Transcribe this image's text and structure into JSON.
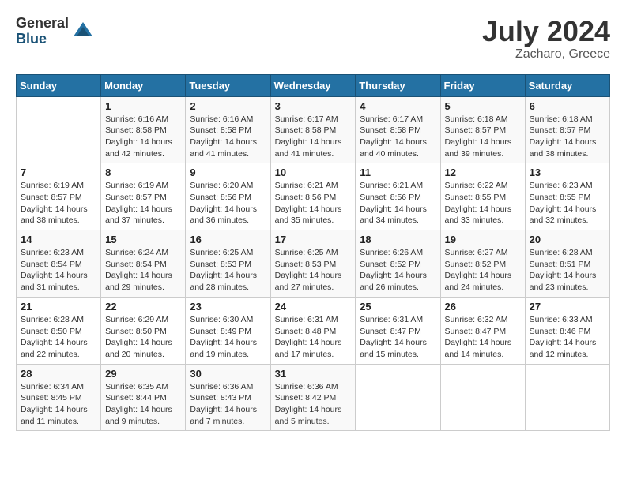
{
  "logo": {
    "general": "General",
    "blue": "Blue"
  },
  "title": {
    "month_year": "July 2024",
    "location": "Zacharo, Greece"
  },
  "headers": [
    "Sunday",
    "Monday",
    "Tuesday",
    "Wednesday",
    "Thursday",
    "Friday",
    "Saturday"
  ],
  "weeks": [
    [
      {
        "day": "",
        "info": ""
      },
      {
        "day": "1",
        "info": "Sunrise: 6:16 AM\nSunset: 8:58 PM\nDaylight: 14 hours\nand 42 minutes."
      },
      {
        "day": "2",
        "info": "Sunrise: 6:16 AM\nSunset: 8:58 PM\nDaylight: 14 hours\nand 41 minutes."
      },
      {
        "day": "3",
        "info": "Sunrise: 6:17 AM\nSunset: 8:58 PM\nDaylight: 14 hours\nand 41 minutes."
      },
      {
        "day": "4",
        "info": "Sunrise: 6:17 AM\nSunset: 8:58 PM\nDaylight: 14 hours\nand 40 minutes."
      },
      {
        "day": "5",
        "info": "Sunrise: 6:18 AM\nSunset: 8:57 PM\nDaylight: 14 hours\nand 39 minutes."
      },
      {
        "day": "6",
        "info": "Sunrise: 6:18 AM\nSunset: 8:57 PM\nDaylight: 14 hours\nand 38 minutes."
      }
    ],
    [
      {
        "day": "7",
        "info": "Sunrise: 6:19 AM\nSunset: 8:57 PM\nDaylight: 14 hours\nand 38 minutes."
      },
      {
        "day": "8",
        "info": "Sunrise: 6:19 AM\nSunset: 8:57 PM\nDaylight: 14 hours\nand 37 minutes."
      },
      {
        "day": "9",
        "info": "Sunrise: 6:20 AM\nSunset: 8:56 PM\nDaylight: 14 hours\nand 36 minutes."
      },
      {
        "day": "10",
        "info": "Sunrise: 6:21 AM\nSunset: 8:56 PM\nDaylight: 14 hours\nand 35 minutes."
      },
      {
        "day": "11",
        "info": "Sunrise: 6:21 AM\nSunset: 8:56 PM\nDaylight: 14 hours\nand 34 minutes."
      },
      {
        "day": "12",
        "info": "Sunrise: 6:22 AM\nSunset: 8:55 PM\nDaylight: 14 hours\nand 33 minutes."
      },
      {
        "day": "13",
        "info": "Sunrise: 6:23 AM\nSunset: 8:55 PM\nDaylight: 14 hours\nand 32 minutes."
      }
    ],
    [
      {
        "day": "14",
        "info": "Sunrise: 6:23 AM\nSunset: 8:54 PM\nDaylight: 14 hours\nand 31 minutes."
      },
      {
        "day": "15",
        "info": "Sunrise: 6:24 AM\nSunset: 8:54 PM\nDaylight: 14 hours\nand 29 minutes."
      },
      {
        "day": "16",
        "info": "Sunrise: 6:25 AM\nSunset: 8:53 PM\nDaylight: 14 hours\nand 28 minutes."
      },
      {
        "day": "17",
        "info": "Sunrise: 6:25 AM\nSunset: 8:53 PM\nDaylight: 14 hours\nand 27 minutes."
      },
      {
        "day": "18",
        "info": "Sunrise: 6:26 AM\nSunset: 8:52 PM\nDaylight: 14 hours\nand 26 minutes."
      },
      {
        "day": "19",
        "info": "Sunrise: 6:27 AM\nSunset: 8:52 PM\nDaylight: 14 hours\nand 24 minutes."
      },
      {
        "day": "20",
        "info": "Sunrise: 6:28 AM\nSunset: 8:51 PM\nDaylight: 14 hours\nand 23 minutes."
      }
    ],
    [
      {
        "day": "21",
        "info": "Sunrise: 6:28 AM\nSunset: 8:50 PM\nDaylight: 14 hours\nand 22 minutes."
      },
      {
        "day": "22",
        "info": "Sunrise: 6:29 AM\nSunset: 8:50 PM\nDaylight: 14 hours\nand 20 minutes."
      },
      {
        "day": "23",
        "info": "Sunrise: 6:30 AM\nSunset: 8:49 PM\nDaylight: 14 hours\nand 19 minutes."
      },
      {
        "day": "24",
        "info": "Sunrise: 6:31 AM\nSunset: 8:48 PM\nDaylight: 14 hours\nand 17 minutes."
      },
      {
        "day": "25",
        "info": "Sunrise: 6:31 AM\nSunset: 8:47 PM\nDaylight: 14 hours\nand 15 minutes."
      },
      {
        "day": "26",
        "info": "Sunrise: 6:32 AM\nSunset: 8:47 PM\nDaylight: 14 hours\nand 14 minutes."
      },
      {
        "day": "27",
        "info": "Sunrise: 6:33 AM\nSunset: 8:46 PM\nDaylight: 14 hours\nand 12 minutes."
      }
    ],
    [
      {
        "day": "28",
        "info": "Sunrise: 6:34 AM\nSunset: 8:45 PM\nDaylight: 14 hours\nand 11 minutes."
      },
      {
        "day": "29",
        "info": "Sunrise: 6:35 AM\nSunset: 8:44 PM\nDaylight: 14 hours\nand 9 minutes."
      },
      {
        "day": "30",
        "info": "Sunrise: 6:36 AM\nSunset: 8:43 PM\nDaylight: 14 hours\nand 7 minutes."
      },
      {
        "day": "31",
        "info": "Sunrise: 6:36 AM\nSunset: 8:42 PM\nDaylight: 14 hours\nand 5 minutes."
      },
      {
        "day": "",
        "info": ""
      },
      {
        "day": "",
        "info": ""
      },
      {
        "day": "",
        "info": ""
      }
    ]
  ]
}
